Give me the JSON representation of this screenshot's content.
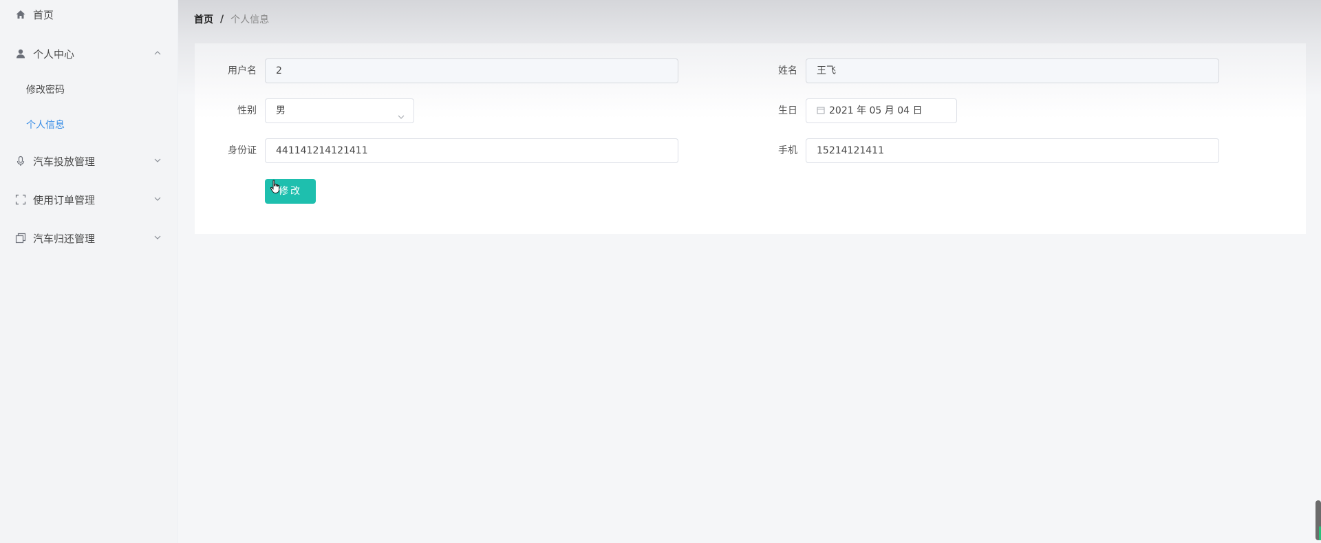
{
  "sidebar": {
    "items": [
      {
        "label": "首页",
        "icon": "home-icon"
      },
      {
        "label": "个人中心",
        "icon": "user-icon",
        "expanded": true
      },
      {
        "label": "汽车投放管理",
        "icon": "microphone-icon",
        "expanded": false
      },
      {
        "label": "使用订单管理",
        "icon": "scan-frame-icon",
        "expanded": false
      },
      {
        "label": "汽车归还管理",
        "icon": "copy-icon",
        "expanded": false
      }
    ],
    "sub_items": [
      {
        "label": "修改密码",
        "active": false
      },
      {
        "label": "个人信息",
        "active": true
      }
    ]
  },
  "breadcrumb": {
    "home": "首页",
    "separator": "/",
    "current": "个人信息"
  },
  "form": {
    "username": {
      "label": "用户名",
      "value": "2"
    },
    "name": {
      "label": "姓名",
      "value": "王飞"
    },
    "gender": {
      "label": "性别",
      "value": "男"
    },
    "birthday": {
      "label": "生日",
      "value": "2021 年 05 月 04 日"
    },
    "id_card": {
      "label": "身份证",
      "value": "441141214121411"
    },
    "phone": {
      "label": "手机",
      "value": "15214121411"
    },
    "submit_label": "修改"
  },
  "colors": {
    "accent": "#1ebfae",
    "active_link": "#3a8ee6"
  }
}
